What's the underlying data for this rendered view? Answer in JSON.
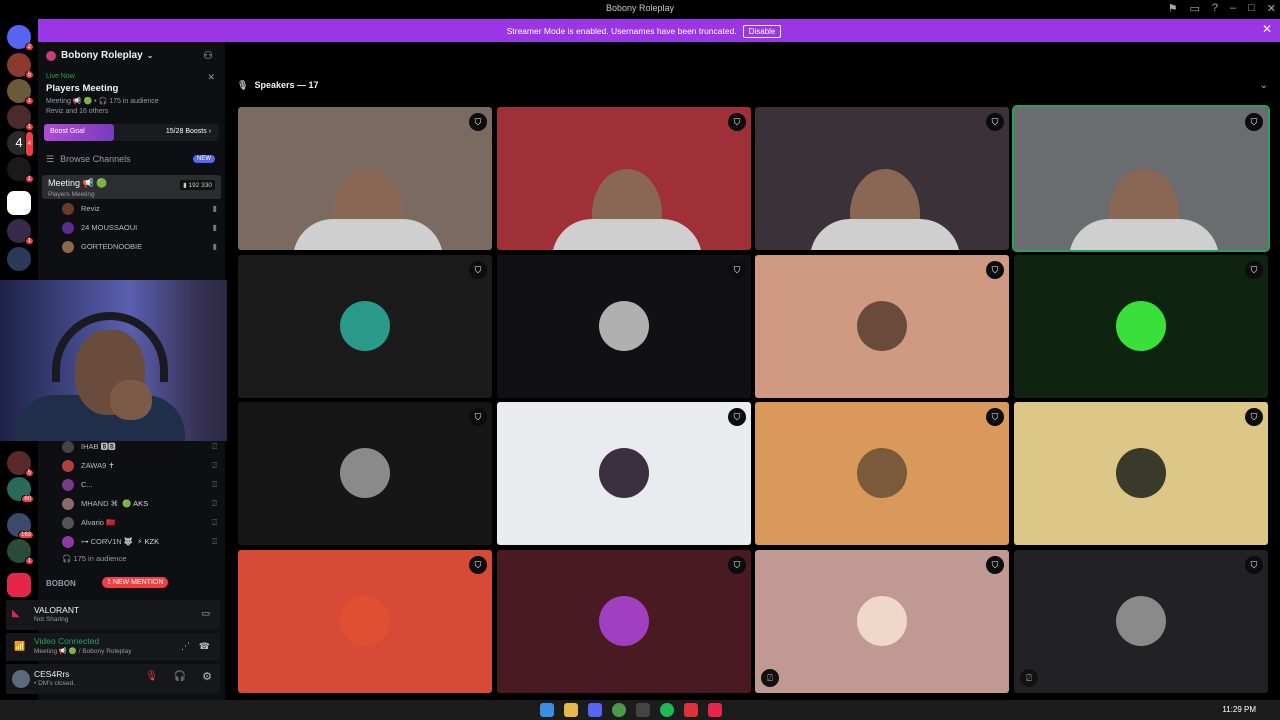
{
  "window": {
    "title": "Bobony Roleplay"
  },
  "banner": {
    "message": "Streamer Mode is enabled. Usernames have been truncated.",
    "disable_label": "Disable",
    "color": "#9b36e6"
  },
  "server_rail": {
    "badges": [
      "2",
      "5",
      "1",
      "1",
      "4",
      "1",
      "1",
      "5",
      "1",
      "60",
      "163",
      "1",
      "1"
    ]
  },
  "sidebar": {
    "server_name": "Bobony Roleplay",
    "live": {
      "tag": "Live Now",
      "stage_name": "Players Meeting",
      "stage_sub": "Meeting 📢 🟢 • 🎧 175 in audience",
      "listeners": "Reviz and 16 others"
    },
    "boost": {
      "label": "Boost Goal",
      "count": "15/28 Boosts ›",
      "progress": 0.54
    },
    "browse": {
      "label": "Browse Channels",
      "badge": "NEW"
    },
    "channel": {
      "name": "Meeting 📢 🟢",
      "sub": "Players Meeting",
      "video_count": "192",
      "user_count": "330"
    },
    "users_top": [
      {
        "name": "Reviz",
        "color": "#6b3b2a"
      },
      {
        "name": "24 MOUSSAOUI",
        "color": "#5a2d8a"
      },
      {
        "name": "GORTEDNOOBIE",
        "color": "#8a6a4a"
      }
    ],
    "users_bottom": [
      {
        "name": "IHAB 🅱🅱",
        "color": "#444",
        "tag": ""
      },
      {
        "name": "ZAWA9 ✝",
        "color": "#b04040",
        "tag": ""
      },
      {
        "name": "C...",
        "color": "#7a3a8a",
        "tag": ""
      },
      {
        "name": "MHAND ⌘",
        "color": "#8a6a6a",
        "tag": "🟢 AKS"
      },
      {
        "name": "Alvario 🇲🇦",
        "color": "#555",
        "tag": ""
      },
      {
        "name": "⊶ CORV1N 🐺",
        "color": "#8a3aa0",
        "tag": "⚡ KZK"
      }
    ],
    "audience": "175 in audience",
    "next_category": "BOBON",
    "mention": "1 NEW MENTION",
    "activity": {
      "game": "VALORANT",
      "status": "Not Sharing"
    },
    "voice": {
      "status": "Video Connected",
      "location": "Meeting 📢 🟢 / Bobony Roleplay"
    },
    "me": {
      "name": "CES4Rrs",
      "status": "• DM's closed."
    }
  },
  "stage": {
    "speakers_label": "Speakers — 17",
    "tiles": [
      {
        "type": "video",
        "bg": "#7a6a60"
      },
      {
        "type": "video",
        "bg": "#a03038"
      },
      {
        "type": "video",
        "bg": "#3a3238"
      },
      {
        "type": "video",
        "bg": "#6a6c70",
        "speaking": true
      },
      {
        "type": "avatar",
        "bg": "#1a1a1a",
        "av": "#2a9a8a",
        "muted": false
      },
      {
        "type": "avatar",
        "bg": "#111113",
        "av": "#b0b0b0",
        "muted": false
      },
      {
        "type": "avatar",
        "bg": "#d09a82",
        "av": "#6a4a3a",
        "muted": false
      },
      {
        "type": "avatar",
        "bg": "#0e2410",
        "av": "#3ae03a",
        "muted": false
      },
      {
        "type": "avatar",
        "bg": "#161616",
        "av": "#8a8a8a",
        "muted": false
      },
      {
        "type": "avatar",
        "bg": "#e8ecef",
        "av": "#3a3040",
        "muted": false
      },
      {
        "type": "avatar",
        "bg": "#d8995a",
        "av": "#7a5a3a",
        "muted": false
      },
      {
        "type": "avatar",
        "bg": "#dcc688",
        "av": "#3a3a2a",
        "muted": false
      },
      {
        "type": "avatar",
        "bg": "#d84a38",
        "av": "#e05030",
        "muted": false
      },
      {
        "type": "avatar",
        "bg": "#4a1a22",
        "av": "#a040c0",
        "muted": false
      },
      {
        "type": "avatar",
        "bg": "#c09a92",
        "av": "#f0d8c8",
        "muted": true
      },
      {
        "type": "avatar",
        "bg": "#222224",
        "av": "#8a8a8a",
        "muted": true
      }
    ]
  },
  "taskbar": {
    "time": "11:29 PM"
  }
}
